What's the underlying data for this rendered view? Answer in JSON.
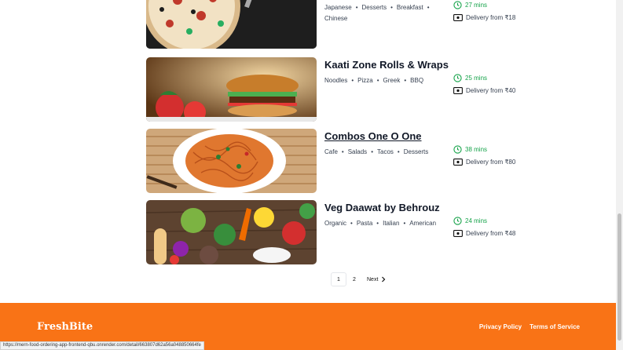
{
  "restaurants": [
    {
      "name": "",
      "tags": [
        "Japanese",
        "Desserts",
        "Breakfast",
        "Chinese"
      ],
      "time": "27 mins",
      "delivery": "Delivery from ₹18"
    },
    {
      "name": "Kaati Zone Rolls & Wraps",
      "tags": [
        "Noodles",
        "Pizza",
        "Greek",
        "BBQ"
      ],
      "time": "25 mins",
      "delivery": "Delivery from ₹40"
    },
    {
      "name": "Combos One O One",
      "tags": [
        "Cafe",
        "Salads",
        "Tacos",
        "Desserts"
      ],
      "time": "38 mins",
      "delivery": "Delivery from ₹80"
    },
    {
      "name": "Veg Daawat by Behrouz",
      "tags": [
        "Organic",
        "Pasta",
        "Italian",
        "American"
      ],
      "time": "24 mins",
      "delivery": "Delivery from ₹48"
    }
  ],
  "pagination": {
    "pages": [
      "1",
      "2"
    ],
    "current": "1",
    "next_label": "Next"
  },
  "footer": {
    "brand": "FreshBite",
    "privacy": "Privacy Policy",
    "terms": "Terms of Service"
  },
  "status_url": "https://mern-food-ordering-app-frontend-qbu.onrender.com/detail/663807d62a56a048850664fe",
  "colors": {
    "accent": "#f97316",
    "time_green": "#16a34a"
  },
  "icons": {
    "time": "clock-icon",
    "delivery": "banknote-icon",
    "next": "chevron-right-icon"
  }
}
